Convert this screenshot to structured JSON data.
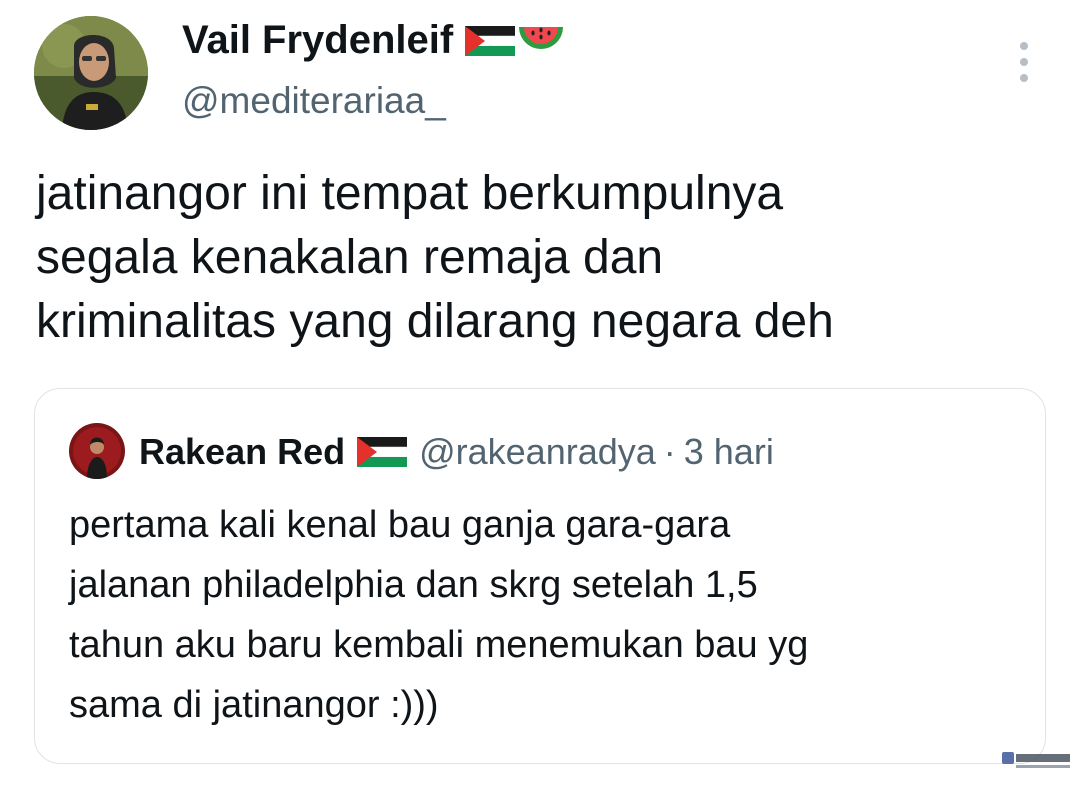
{
  "author": {
    "name": "Vail Frydenleif",
    "handle": "@mediterariaa_",
    "avatar_icon": "avatar-photo-icon",
    "badges": [
      "palestine-flag-icon",
      "watermelon-icon"
    ]
  },
  "menu": {
    "icon": "more-vertical-icon"
  },
  "tweet": {
    "lines": [
      "jatinangor ini tempat berkumpulnya",
      "segala kenakalan remaja dan",
      "kriminalitas yang dilarang negara deh"
    ]
  },
  "quote": {
    "name": "Rakean Red",
    "handle": "@rakeanradya",
    "separator": "·",
    "time": "3 hari",
    "avatar_icon": "avatar-photo-icon",
    "badges": [
      "palestine-flag-icon"
    ],
    "lines": [
      "pertama kali kenal bau ganja gara-gara",
      "jalanan philadelphia dan skrg setelah 1,5",
      "tahun aku baru kembali menemukan bau yg",
      "sama di jatinangor :)))"
    ]
  },
  "colors": {
    "text_primary": "#0f1419",
    "text_secondary": "#536471",
    "border": "#dfe3e7",
    "flag_red": "#e4312b",
    "flag_green": "#149954",
    "melon_green": "#2e9b3e",
    "melon_red": "#f0484e"
  }
}
